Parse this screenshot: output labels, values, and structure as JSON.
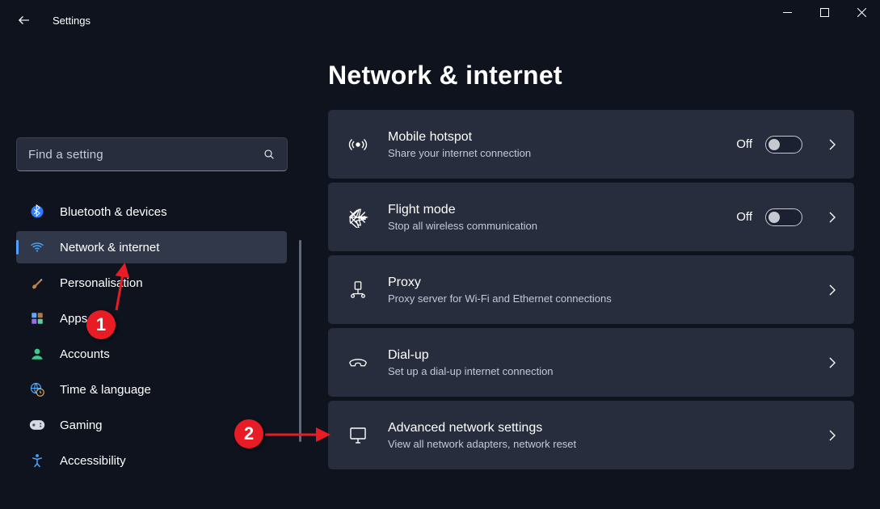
{
  "titlebar": {
    "app_name": "Settings"
  },
  "search": {
    "placeholder": "Find a setting"
  },
  "nav": {
    "items": [
      {
        "label": "Bluetooth & devices"
      },
      {
        "label": "Network & internet"
      },
      {
        "label": "Personalisation"
      },
      {
        "label": "Apps"
      },
      {
        "label": "Accounts"
      },
      {
        "label": "Time & language"
      },
      {
        "label": "Gaming"
      },
      {
        "label": "Accessibility"
      }
    ],
    "active_index": 1
  },
  "page": {
    "title": "Network & internet"
  },
  "cards": [
    {
      "title": "Mobile hotspot",
      "sub": "Share your internet connection",
      "toggle_state": "Off",
      "has_toggle": true
    },
    {
      "title": "Flight mode",
      "sub": "Stop all wireless communication",
      "toggle_state": "Off",
      "has_toggle": true
    },
    {
      "title": "Proxy",
      "sub": "Proxy server for Wi-Fi and Ethernet connections",
      "has_toggle": false
    },
    {
      "title": "Dial-up",
      "sub": "Set up a dial-up internet connection",
      "has_toggle": false
    },
    {
      "title": "Advanced network settings",
      "sub": "View all network adapters, network reset",
      "has_toggle": false
    }
  ],
  "annotations": [
    {
      "num": "1"
    },
    {
      "num": "2"
    }
  ]
}
